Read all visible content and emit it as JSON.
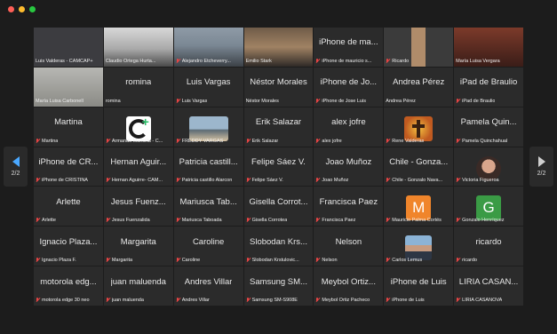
{
  "page": {
    "current": "2/2"
  },
  "colors": {
    "active_speaker": "#39c35a",
    "muted": "#e84545",
    "tile_bg": "#2b2b2b",
    "m_avatar": "#f0852b",
    "g_avatar": "#3a9b45"
  },
  "tiles": [
    {
      "display": "",
      "label": "Luis Valderas - CAMCAP+",
      "muted": false,
      "visual": "v-labels",
      "icon": "video-feed"
    },
    {
      "display": "",
      "label": "Claudio Ortega Hurta...",
      "muted": false,
      "visual": "v-person1",
      "icon": "video-feed"
    },
    {
      "display": "",
      "label": "Alejandro Etcheverry...",
      "muted": true,
      "visual": "v-person2",
      "icon": "video-feed"
    },
    {
      "display": "",
      "label": "Emilio Stark",
      "muted": false,
      "visual": "v-person3",
      "icon": "video-feed"
    },
    {
      "display": "iPhone de ma...",
      "label": "iPhone de mauricio s...",
      "muted": true
    },
    {
      "display": "",
      "label": "Ricardo",
      "muted": true,
      "visual": "v-ricardo",
      "icon": "video-feed"
    },
    {
      "display": "",
      "label": "María Luisa Vergara",
      "muted": false,
      "visual": "v-maria",
      "icon": "video-feed"
    },
    {
      "display": "",
      "label": "María Luisa Carbonell",
      "muted": false,
      "visual": "v-maria2",
      "icon": "video-feed"
    },
    {
      "display": "romina",
      "label": "romina",
      "muted": false
    },
    {
      "display": "Luis Vargas",
      "label": "Luis Vargas",
      "muted": true
    },
    {
      "display": "Néstor Morales",
      "label": "Néstor Morales",
      "muted": false
    },
    {
      "display": "iPhone de Jo...",
      "label": "iPhone de Jose Luis",
      "muted": true
    },
    {
      "display": "Andrea Pérez",
      "label": "Andrea Pérez",
      "muted": false
    },
    {
      "display": "iPad de Braulio",
      "label": "iPad de Braulio",
      "muted": true
    },
    {
      "display": "Martina",
      "label": "Martina",
      "muted": true
    },
    {
      "display": "",
      "label": "Armando Mancilla - C...",
      "muted": true,
      "thumb": "thumb-logo",
      "icon": "profile-logo"
    },
    {
      "display": "",
      "label": "FREDDY VARGAS",
      "muted": true,
      "thumb": "thumb-beach",
      "icon": "profile-photo"
    },
    {
      "display": "Erik Salazar",
      "label": "Erik Salazar",
      "muted": true
    },
    {
      "display": "alex jofre",
      "label": "alex jofre",
      "muted": true
    },
    {
      "display": "",
      "label": "Rene Valderas",
      "muted": true,
      "thumb": "thumb-cross",
      "icon": "profile-photo"
    },
    {
      "display": "Pamela Quin...",
      "label": "Pamela Quinchahual",
      "muted": true
    },
    {
      "display": "iPhone de CR...",
      "label": "iPhone de CRISTINA",
      "muted": true
    },
    {
      "display": "Hernan Aguir...",
      "label": "Hernan Aguirre- CAM...",
      "muted": true
    },
    {
      "display": "Patricia castill...",
      "label": "Patricia castillo Alarcon",
      "muted": true
    },
    {
      "display": "Felipe Sáez V.",
      "label": "Felipe Sáez V.",
      "muted": true
    },
    {
      "display": "Joao Muñoz",
      "label": "Joao Muñoz",
      "muted": true
    },
    {
      "display": "Chile - Gonza...",
      "label": "Chile - Gonzalo Nava...",
      "muted": true
    },
    {
      "display": "",
      "label": "Victoria Figueroa",
      "muted": true,
      "thumb": "thumb-girl",
      "icon": "profile-photo"
    },
    {
      "display": "Arlette",
      "label": "Arlette",
      "muted": true
    },
    {
      "display": "Jesus Fuenz...",
      "label": "Jesus Fuenzalida",
      "muted": true
    },
    {
      "display": "Mariusca Tab...",
      "label": "Mariusca Taboada",
      "muted": true
    },
    {
      "display": "Gisella Corrot...",
      "label": "Gisella Corrotea",
      "muted": true
    },
    {
      "display": "Francisca Paez",
      "label": "Francisca Paez",
      "muted": true
    },
    {
      "display": "",
      "label": "Mauricio Palma Cortés",
      "muted": true,
      "letter": "M",
      "letter_color": "#f0852b",
      "icon": "letter-avatar"
    },
    {
      "display": "",
      "label": "Gonzalo Henríquez",
      "muted": true,
      "letter": "G",
      "letter_color": "#3a9b45",
      "icon": "letter-avatar"
    },
    {
      "display": "Ignacio Plaza...",
      "label": "Ignacio Plaza F.",
      "muted": true
    },
    {
      "display": "Margarita",
      "label": "Margarita",
      "muted": true
    },
    {
      "display": "Caroline",
      "label": "Caroline",
      "muted": true
    },
    {
      "display": "Slobodan Krs...",
      "label": "Slobodan Krstulovic...",
      "muted": true
    },
    {
      "display": "Nelson",
      "label": "Nelson",
      "muted": true
    },
    {
      "display": "",
      "label": "Carlos Lemus",
      "muted": true,
      "thumb": "thumb-carlos",
      "icon": "profile-photo"
    },
    {
      "display": "ricardo",
      "label": "ricardo",
      "muted": true
    },
    {
      "display": "motorola edg...",
      "label": "motorola edge 30 neo",
      "muted": true
    },
    {
      "display": "juan maluenda",
      "label": "juan maluenda",
      "muted": true
    },
    {
      "display": "Andres Villar",
      "label": "Andres Villar",
      "muted": true
    },
    {
      "display": "Samsung SM...",
      "label": "Samsung SM-S908E",
      "muted": true
    },
    {
      "display": "Meybol Ortiz...",
      "label": "Meybol Ortiz Pacheco",
      "muted": true
    },
    {
      "display": "iPhone de Luis",
      "label": "iPhone de Luis",
      "muted": true
    },
    {
      "display": "LIRIA CASAN...",
      "label": "LIRIA CASANOVA",
      "muted": true
    }
  ]
}
